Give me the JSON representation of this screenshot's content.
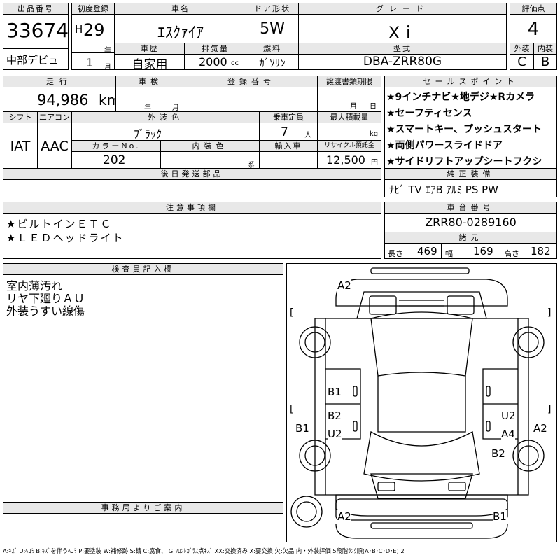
{
  "lot": {
    "label": "出品番号",
    "value": "33674",
    "debut": "中部デビュ"
  },
  "first_reg": {
    "label": "初度登録",
    "era": "H",
    "year": "29",
    "year_unit": "年",
    "month": "1",
    "month_unit": "月"
  },
  "car_name": {
    "label": "車名",
    "value": "ｴｽｸｧｲｱ"
  },
  "door": {
    "label": "ドア形状",
    "value": "5W"
  },
  "grade": {
    "label": "グレード",
    "value": "Xｉ"
  },
  "score": {
    "label": "評価点",
    "value": "4"
  },
  "history": {
    "label": "車歴",
    "value": "自家用"
  },
  "displacement": {
    "label": "排気量",
    "value": "2000",
    "unit": "cc"
  },
  "fuel": {
    "label": "燃料",
    "value": "ｶﾞｿﾘﾝ"
  },
  "model": {
    "label": "型式",
    "value": "DBA-ZRR80G"
  },
  "exterior": {
    "label": "外装",
    "value": "C"
  },
  "interior": {
    "label": "内装",
    "value": "B"
  },
  "mileage": {
    "label": "走行",
    "value": "94,986",
    "unit": "km"
  },
  "inspection": {
    "label": "車検",
    "year_unit": "年",
    "month_unit": "月"
  },
  "reg_number": {
    "label": "登録番号"
  },
  "transfer": {
    "label": "譲渡書類期限",
    "month_unit": "月",
    "day_unit": "日"
  },
  "shift": {
    "label": "シフト",
    "value": "IAT"
  },
  "aircon": {
    "label": "エアコン",
    "value": "AAC"
  },
  "ext_color": {
    "label": "外装色",
    "value": "ﾌﾞﾗｯｸ"
  },
  "capacity": {
    "label": "乗車定員",
    "value": "7",
    "unit": "人"
  },
  "max_load": {
    "label": "最大積載量",
    "unit": "kg"
  },
  "color_no": {
    "label": "カラーNo.",
    "value": "202"
  },
  "int_color": {
    "label": "内装色",
    "unit": "系"
  },
  "import": {
    "label": "輸入車"
  },
  "recycle": {
    "label": "リサイクル預託金",
    "value": "12,500",
    "unit": "円"
  },
  "later": {
    "label": "後日発送部品"
  },
  "sales_points": {
    "label": "セールスポイント",
    "items": [
      "★9インチナビ★地デジ★Rカメラ",
      "★セーフティセンス",
      "★スマートキー、プッシュスタート",
      "★両側パワースライドドア",
      "★サイドリフトアップシートフクシ"
    ]
  },
  "equipment": {
    "label": "純正装備",
    "value": "ﾅﾋﾞ TV ｴｱB ｱﾙﾐ PS PW"
  },
  "notes": {
    "label": "注意事項欄",
    "items": [
      "★ビルトインＥＴＣ",
      "★ＬＥＤヘッドライト"
    ]
  },
  "chassis": {
    "label": "車台番号",
    "value": "ZRR80-0289160"
  },
  "dims": {
    "label": "諸元",
    "length_label": "長さ",
    "length": "469",
    "width_label": "幅",
    "width": "169",
    "height_label": "高さ",
    "height": "182"
  },
  "inspector": {
    "label": "検査員記入欄",
    "lines": [
      "室内薄汚れ",
      "リヤ下廻りＡＵ",
      "外装うすい線傷"
    ]
  },
  "office": {
    "label": "事務局よりご案内"
  },
  "diagram_marks": {
    "a2_top": "A2",
    "b1_front": "B1",
    "b2_front": "B2",
    "u2_left": "U2",
    "b1_side": "B1",
    "u2_right": "U2",
    "a4": "A4",
    "a2_side": "A2",
    "b2_rear": "B2",
    "a2_bottom": "A2",
    "b1_bottom": "B1",
    "bracket_l": "[",
    "bracket_r": "]"
  },
  "legend": "A:ｷｽﾞ U:ﾍｺﾐ B:ｷｽﾞを伴うﾍｺﾐ P:要塗装 W:補修跡 S:錆 C:腐食、 G:ﾌﾛﾝﾄｶﾞﾗｽ点ｷｽﾞ XX:交換済み X:要交換 欠:欠品 内・外装評価 5段階ﾗﾝｸ順(A･B･C･D･E) 2"
}
